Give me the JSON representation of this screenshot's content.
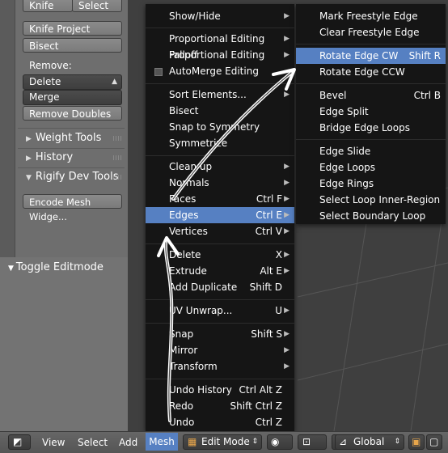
{
  "tool_shelf": {
    "knife_label": "Knife",
    "select_label": "Select",
    "knife_project_label": "Knife Project",
    "bisect_label": "Bisect",
    "remove_heading": "Remove:",
    "delete_label": "Delete",
    "merge_label": "Merge",
    "remove_doubles_label": "Remove Doubles",
    "weight_tools_label": "Weight Tools",
    "history_label": "History",
    "rigify_label": "Rigify Dev Tools",
    "encode_mesh_label": "Encode Mesh Widge...",
    "toggle_editmode_label": "Toggle Editmode"
  },
  "mesh_menu": {
    "items": [
      {
        "label": "Show/Hide",
        "shortcut": "",
        "submenu": true
      },
      {
        "label": "Proportional Editing Falloff",
        "shortcut": "",
        "submenu": true
      },
      {
        "label": "Proportional Editing",
        "shortcut": "",
        "submenu": true
      },
      {
        "label": "AutoMerge Editing",
        "shortcut": "",
        "submenu": false
      },
      {
        "label": "Sort Elements...",
        "shortcut": "",
        "submenu": true
      },
      {
        "label": "Bisect",
        "shortcut": "",
        "submenu": false
      },
      {
        "label": "Snap to Symmetry",
        "shortcut": "",
        "submenu": false
      },
      {
        "label": "Symmetrize",
        "shortcut": "",
        "submenu": false
      },
      {
        "label": "Clean up",
        "shortcut": "",
        "submenu": true
      },
      {
        "label": "Normals",
        "shortcut": "",
        "submenu": true
      },
      {
        "label": "Faces",
        "shortcut": "Ctrl F",
        "submenu": true
      },
      {
        "label": "Edges",
        "shortcut": "Ctrl E",
        "submenu": true
      },
      {
        "label": "Vertices",
        "shortcut": "Ctrl V",
        "submenu": true
      },
      {
        "label": "Delete",
        "shortcut": "X",
        "submenu": true
      },
      {
        "label": "Extrude",
        "shortcut": "Alt E",
        "submenu": true
      },
      {
        "label": "Add Duplicate",
        "shortcut": "Shift D",
        "submenu": false
      },
      {
        "label": "UV Unwrap...",
        "shortcut": "U",
        "submenu": true
      },
      {
        "label": "Snap",
        "shortcut": "Shift S",
        "submenu": true
      },
      {
        "label": "Mirror",
        "shortcut": "",
        "submenu": true
      },
      {
        "label": "Transform",
        "shortcut": "",
        "submenu": true
      },
      {
        "label": "Undo History",
        "shortcut": "Ctrl Alt Z",
        "submenu": false
      },
      {
        "label": "Redo",
        "shortcut": "Shift Ctrl Z",
        "submenu": false
      },
      {
        "label": "Undo",
        "shortcut": "Ctrl Z",
        "submenu": false
      }
    ]
  },
  "edges_menu": {
    "items": [
      {
        "label": "Mark Freestyle Edge",
        "shortcut": ""
      },
      {
        "label": "Clear Freestyle Edge",
        "shortcut": ""
      },
      {
        "label": "Rotate Edge CW",
        "shortcut": "Shift R"
      },
      {
        "label": "Rotate Edge CCW",
        "shortcut": ""
      },
      {
        "label": "Bevel",
        "shortcut": "Ctrl B"
      },
      {
        "label": "Edge Split",
        "shortcut": ""
      },
      {
        "label": "Bridge Edge Loops",
        "shortcut": ""
      },
      {
        "label": "Edge Slide",
        "shortcut": ""
      },
      {
        "label": "Edge Loops",
        "shortcut": ""
      },
      {
        "label": "Edge Rings",
        "shortcut": ""
      },
      {
        "label": "Select Loop Inner-Region",
        "shortcut": ""
      },
      {
        "label": "Select Boundary Loop",
        "shortcut": ""
      }
    ]
  },
  "header": {
    "view_label": "View",
    "select_label": "Select",
    "add_label": "Add",
    "mesh_label": "Mesh",
    "mode_label": "Edit Mode",
    "orientation_label": "Global"
  },
  "colors": {
    "highlight": "#5680c2",
    "menu_bg": "#151515"
  }
}
